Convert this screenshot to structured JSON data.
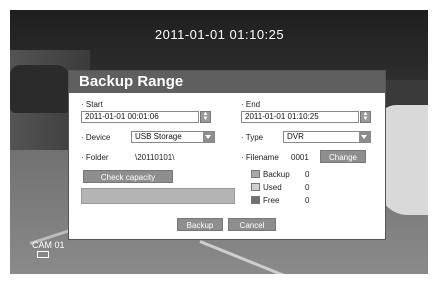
{
  "screen": {
    "timestamp": "2011-01-01 01:10:25",
    "camera": "CAM 01"
  },
  "dialog": {
    "title": "Backup Range",
    "start_label": "Start",
    "start_value": "2011-01-01 00:01:06",
    "end_label": "End",
    "end_value": "2011-01-01 01:10:25",
    "device_label": "Device",
    "device_value": "USB Storage",
    "type_label": "Type",
    "type_value": "DVR",
    "folder_label": "Folder",
    "folder_value": "\\20110101\\",
    "filename_label": "Filename",
    "filename_value": "0001",
    "change_button": "Change",
    "check_capacity_button": "Check capacity",
    "legend": [
      {
        "label": "Backup",
        "value": "0",
        "color": "#a8a8a8"
      },
      {
        "label": "Used",
        "value": "0",
        "color": "#d0d0d0"
      },
      {
        "label": "Free",
        "value": "0",
        "color": "#6e6e6e"
      }
    ],
    "backup_button": "Backup",
    "cancel_button": "Cancel"
  }
}
